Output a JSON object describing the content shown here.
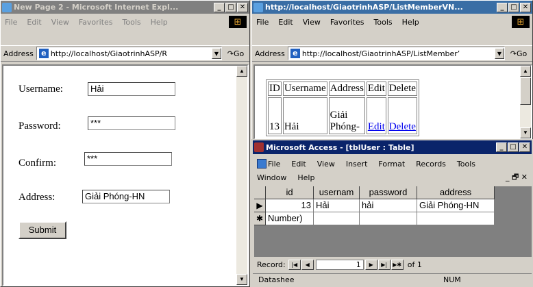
{
  "ie1": {
    "title": "New Page 2 - Microsoft Internet Expl...",
    "menu": [
      "File",
      "Edit",
      "View",
      "Favorites",
      "Tools",
      "Help"
    ],
    "address_label": "Address",
    "url": "http://localhost/GiaotrinhASP/R",
    "go": "Go",
    "form": {
      "username_label": "Username:",
      "username_value": "Hải",
      "password_label": "Password:",
      "password_value": "***",
      "confirm_label": "Confirm:",
      "confirm_value": "***",
      "address_label": "Address:",
      "address_value": "Giải Phóng-HN",
      "submit": "Submit"
    }
  },
  "ie2": {
    "title": "http://localhost/GiaotrinhASP/ListMemberVN...",
    "menu": [
      "File",
      "Edit",
      "View",
      "Favorites",
      "Tools",
      "Help"
    ],
    "address_label": "Address",
    "url": "http://localhost/GiaotrinhASP/ListMember’",
    "go": "Go",
    "table": {
      "headers": [
        "ID",
        "Username",
        "Address",
        "Edit",
        "Delete"
      ],
      "row": {
        "id": "13",
        "username": "Hải",
        "address_l1": "Giải",
        "address_l2": "Phóng-",
        "edit": "Edit",
        "delete": "Delete"
      }
    }
  },
  "access": {
    "title": "Microsoft Access - [tblUser : Table]",
    "menu_row1": [
      "File",
      "Edit",
      "View",
      "Insert",
      "Format",
      "Records",
      "Tools"
    ],
    "menu_row2": [
      "Window",
      "Help"
    ],
    "columns": [
      "id",
      "usernam",
      "password",
      "address"
    ],
    "row1": {
      "id": "13",
      "username": "Hải",
      "password": "hải",
      "address": "Giải Phóng-HN"
    },
    "newrow": {
      "id": "Number)"
    },
    "record_label": "Record:",
    "record_num": "1",
    "of_label": "of 1",
    "status_left": "Datashee",
    "status_right": "NUM"
  },
  "icons": {
    "restore": "🗗",
    "close": "✕",
    "minimize": "_"
  }
}
